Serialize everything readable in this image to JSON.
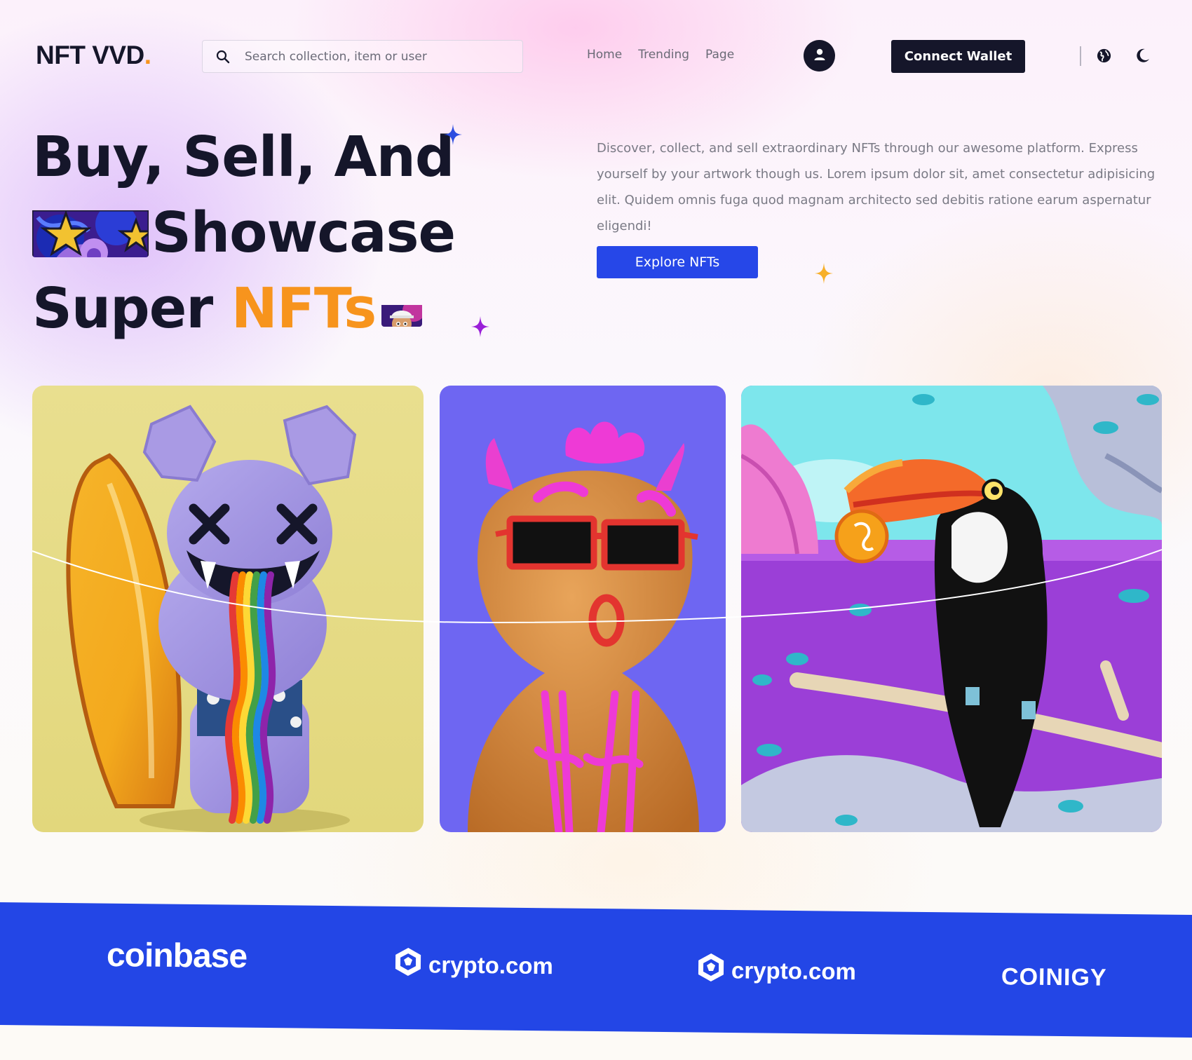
{
  "brand": {
    "logo_text": "NFT VVD",
    "logo_dot": ".",
    "accent_color": "#f7941d",
    "dark_color": "#15162a",
    "primary_color": "#2647e8"
  },
  "search": {
    "placeholder": "Search collection, item or user",
    "value": "",
    "icon": "search-icon"
  },
  "nav": {
    "items": [
      {
        "label": "Home"
      },
      {
        "label": "Trending"
      },
      {
        "label": "Page"
      }
    ]
  },
  "header": {
    "user_icon": "user-icon",
    "connect_label": "Connect Wallet",
    "language_icon": "globe-icon",
    "theme_icon": "moon-icon"
  },
  "hero": {
    "title_line1": "Buy, Sell, And",
    "title_line2": "Showcase",
    "title_line3_prefix": "Super ",
    "title_line3_accent": "NFTs",
    "description": "Discover, collect, and sell extraordinary NFTs through our awesome platform. Express yourself by your artwork though us. Lorem ipsum dolor sit, amet consectetur adipisicing elit. Quidem omnis fuga quod magnam architecto sed debitis ratione earum aspernatur eligendi!",
    "cta_label": "Explore NFTs"
  },
  "featured": [
    {
      "subject": "purple bear figure with surfboard and rainbow"
    },
    {
      "subject": "gingerbread character with sunglasses and pink horns"
    },
    {
      "subject": "toucan on a branch holding a coin"
    }
  ],
  "partners": [
    {
      "name": "coinbase"
    },
    {
      "name": "crypto.com"
    },
    {
      "name": "crypto.com"
    },
    {
      "name": "COINIGY"
    }
  ],
  "colors": {
    "band_blue": "#2346e6",
    "band_yellow": "#f5f21a"
  }
}
